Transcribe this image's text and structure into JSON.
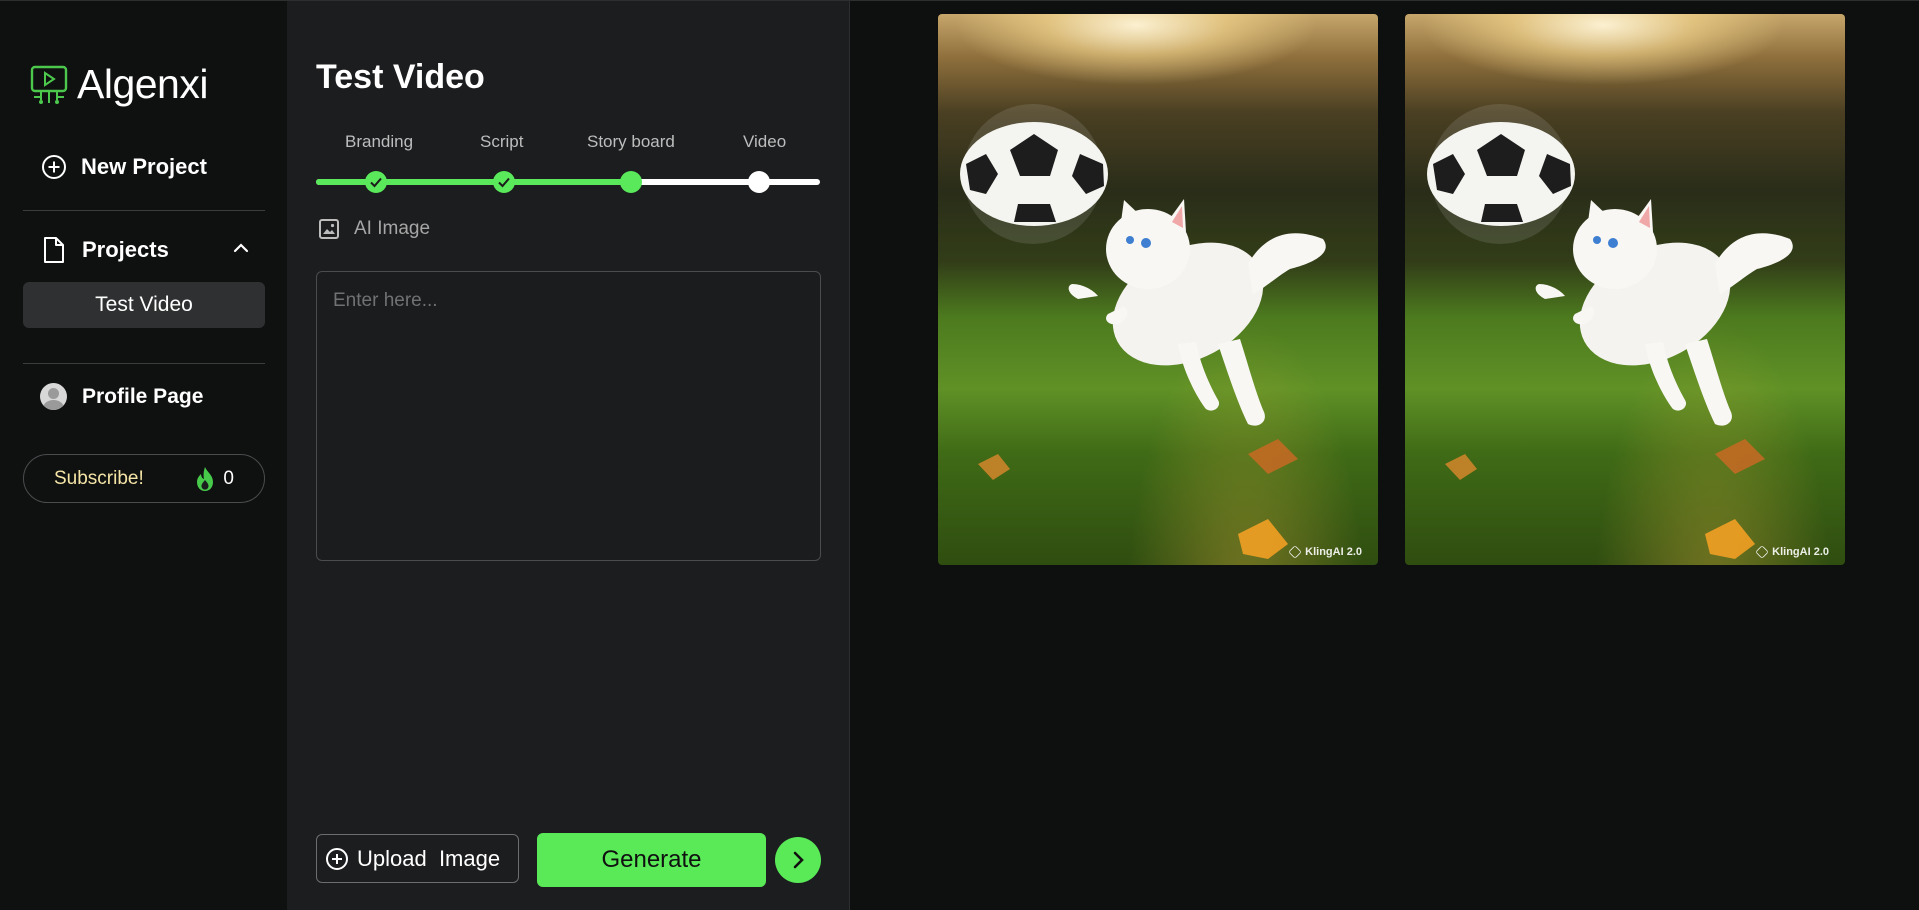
{
  "app": {
    "name": "Algenxi"
  },
  "sidebar": {
    "new_project": "New Project",
    "projects": {
      "label": "Projects",
      "items": [
        {
          "label": "Test Video"
        }
      ]
    },
    "profile": "Profile Page",
    "subscribe": {
      "label": "Subscribe!",
      "credits": "0"
    }
  },
  "editor": {
    "title": "Test Video",
    "steps": [
      {
        "label": "Branding",
        "state": "done"
      },
      {
        "label": "Script",
        "state": "done"
      },
      {
        "label": "Story board",
        "state": "done"
      },
      {
        "label": "Video",
        "state": "current"
      }
    ],
    "mode": "AI Image",
    "prompt": {
      "value": "",
      "placeholder": "Enter here..."
    },
    "upload_label": "Upload  Image",
    "generate_label": "Generate"
  },
  "gallery": {
    "images": [
      {
        "subject": "white kitten leaping at a soccer ball",
        "watermark": "KlingAI 2.0"
      },
      {
        "subject": "white kitten leaping at a soccer ball",
        "watermark": "KlingAI 2.0"
      }
    ]
  },
  "colors": {
    "accent": "#5aea58",
    "background": "#0e0f0f",
    "panel": "#1c1d1f",
    "subscribe_text": "#f4e4a6"
  },
  "icons": [
    "monitor-logo-icon",
    "plus-circle-icon",
    "document-icon",
    "chevron-up-icon",
    "avatar",
    "fire-icon",
    "image-icon",
    "check-icon",
    "chevron-right-icon"
  ]
}
